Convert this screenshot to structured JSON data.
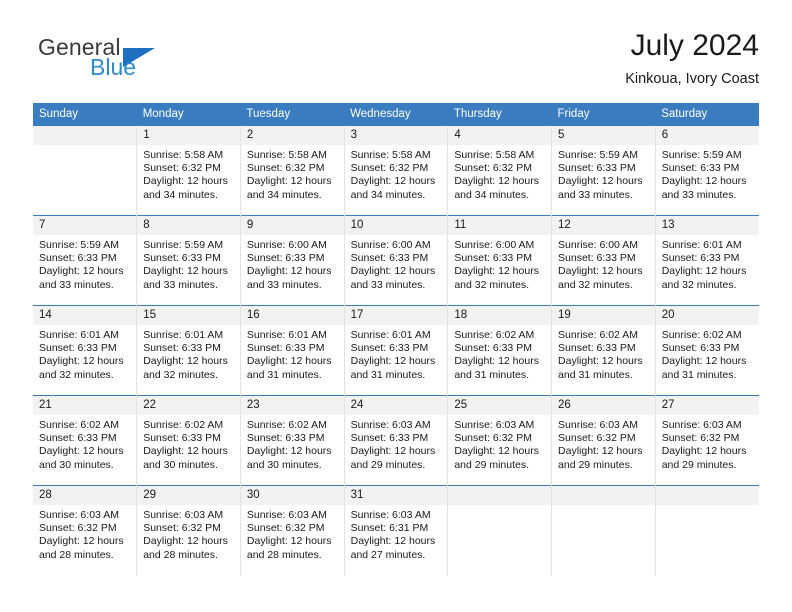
{
  "brand": {
    "word_one": "General",
    "word_two": "Blue"
  },
  "header": {
    "title": "July 2024",
    "subtitle": "Kinkoua, Ivory Coast"
  },
  "colors": {
    "header_blue": "#3a7cc0",
    "logo_blue": "#2e8bd0",
    "logo_triangle": "#1f6fc0",
    "daynum_band": "#f2f2f2",
    "cell_divider": "#e2e2e2"
  },
  "weekdays": [
    "Sunday",
    "Monday",
    "Tuesday",
    "Wednesday",
    "Thursday",
    "Friday",
    "Saturday"
  ],
  "weeks": [
    [
      {
        "day": "",
        "lines": []
      },
      {
        "day": "1",
        "lines": [
          "Sunrise: 5:58 AM",
          "Sunset: 6:32 PM",
          "Daylight: 12 hours",
          "and 34 minutes."
        ]
      },
      {
        "day": "2",
        "lines": [
          "Sunrise: 5:58 AM",
          "Sunset: 6:32 PM",
          "Daylight: 12 hours",
          "and 34 minutes."
        ]
      },
      {
        "day": "3",
        "lines": [
          "Sunrise: 5:58 AM",
          "Sunset: 6:32 PM",
          "Daylight: 12 hours",
          "and 34 minutes."
        ]
      },
      {
        "day": "4",
        "lines": [
          "Sunrise: 5:58 AM",
          "Sunset: 6:32 PM",
          "Daylight: 12 hours",
          "and 34 minutes."
        ]
      },
      {
        "day": "5",
        "lines": [
          "Sunrise: 5:59 AM",
          "Sunset: 6:33 PM",
          "Daylight: 12 hours",
          "and 33 minutes."
        ]
      },
      {
        "day": "6",
        "lines": [
          "Sunrise: 5:59 AM",
          "Sunset: 6:33 PM",
          "Daylight: 12 hours",
          "and 33 minutes."
        ]
      }
    ],
    [
      {
        "day": "7",
        "lines": [
          "Sunrise: 5:59 AM",
          "Sunset: 6:33 PM",
          "Daylight: 12 hours",
          "and 33 minutes."
        ]
      },
      {
        "day": "8",
        "lines": [
          "Sunrise: 5:59 AM",
          "Sunset: 6:33 PM",
          "Daylight: 12 hours",
          "and 33 minutes."
        ]
      },
      {
        "day": "9",
        "lines": [
          "Sunrise: 6:00 AM",
          "Sunset: 6:33 PM",
          "Daylight: 12 hours",
          "and 33 minutes."
        ]
      },
      {
        "day": "10",
        "lines": [
          "Sunrise: 6:00 AM",
          "Sunset: 6:33 PM",
          "Daylight: 12 hours",
          "and 33 minutes."
        ]
      },
      {
        "day": "11",
        "lines": [
          "Sunrise: 6:00 AM",
          "Sunset: 6:33 PM",
          "Daylight: 12 hours",
          "and 32 minutes."
        ]
      },
      {
        "day": "12",
        "lines": [
          "Sunrise: 6:00 AM",
          "Sunset: 6:33 PM",
          "Daylight: 12 hours",
          "and 32 minutes."
        ]
      },
      {
        "day": "13",
        "lines": [
          "Sunrise: 6:01 AM",
          "Sunset: 6:33 PM",
          "Daylight: 12 hours",
          "and 32 minutes."
        ]
      }
    ],
    [
      {
        "day": "14",
        "lines": [
          "Sunrise: 6:01 AM",
          "Sunset: 6:33 PM",
          "Daylight: 12 hours",
          "and 32 minutes."
        ]
      },
      {
        "day": "15",
        "lines": [
          "Sunrise: 6:01 AM",
          "Sunset: 6:33 PM",
          "Daylight: 12 hours",
          "and 32 minutes."
        ]
      },
      {
        "day": "16",
        "lines": [
          "Sunrise: 6:01 AM",
          "Sunset: 6:33 PM",
          "Daylight: 12 hours",
          "and 31 minutes."
        ]
      },
      {
        "day": "17",
        "lines": [
          "Sunrise: 6:01 AM",
          "Sunset: 6:33 PM",
          "Daylight: 12 hours",
          "and 31 minutes."
        ]
      },
      {
        "day": "18",
        "lines": [
          "Sunrise: 6:02 AM",
          "Sunset: 6:33 PM",
          "Daylight: 12 hours",
          "and 31 minutes."
        ]
      },
      {
        "day": "19",
        "lines": [
          "Sunrise: 6:02 AM",
          "Sunset: 6:33 PM",
          "Daylight: 12 hours",
          "and 31 minutes."
        ]
      },
      {
        "day": "20",
        "lines": [
          "Sunrise: 6:02 AM",
          "Sunset: 6:33 PM",
          "Daylight: 12 hours",
          "and 31 minutes."
        ]
      }
    ],
    [
      {
        "day": "21",
        "lines": [
          "Sunrise: 6:02 AM",
          "Sunset: 6:33 PM",
          "Daylight: 12 hours",
          "and 30 minutes."
        ]
      },
      {
        "day": "22",
        "lines": [
          "Sunrise: 6:02 AM",
          "Sunset: 6:33 PM",
          "Daylight: 12 hours",
          "and 30 minutes."
        ]
      },
      {
        "day": "23",
        "lines": [
          "Sunrise: 6:02 AM",
          "Sunset: 6:33 PM",
          "Daylight: 12 hours",
          "and 30 minutes."
        ]
      },
      {
        "day": "24",
        "lines": [
          "Sunrise: 6:03 AM",
          "Sunset: 6:33 PM",
          "Daylight: 12 hours",
          "and 29 minutes."
        ]
      },
      {
        "day": "25",
        "lines": [
          "Sunrise: 6:03 AM",
          "Sunset: 6:32 PM",
          "Daylight: 12 hours",
          "and 29 minutes."
        ]
      },
      {
        "day": "26",
        "lines": [
          "Sunrise: 6:03 AM",
          "Sunset: 6:32 PM",
          "Daylight: 12 hours",
          "and 29 minutes."
        ]
      },
      {
        "day": "27",
        "lines": [
          "Sunrise: 6:03 AM",
          "Sunset: 6:32 PM",
          "Daylight: 12 hours",
          "and 29 minutes."
        ]
      }
    ],
    [
      {
        "day": "28",
        "lines": [
          "Sunrise: 6:03 AM",
          "Sunset: 6:32 PM",
          "Daylight: 12 hours",
          "and 28 minutes."
        ]
      },
      {
        "day": "29",
        "lines": [
          "Sunrise: 6:03 AM",
          "Sunset: 6:32 PM",
          "Daylight: 12 hours",
          "and 28 minutes."
        ]
      },
      {
        "day": "30",
        "lines": [
          "Sunrise: 6:03 AM",
          "Sunset: 6:32 PM",
          "Daylight: 12 hours",
          "and 28 minutes."
        ]
      },
      {
        "day": "31",
        "lines": [
          "Sunrise: 6:03 AM",
          "Sunset: 6:31 PM",
          "Daylight: 12 hours",
          "and 27 minutes."
        ]
      },
      {
        "day": "",
        "lines": []
      },
      {
        "day": "",
        "lines": []
      },
      {
        "day": "",
        "lines": []
      }
    ]
  ]
}
